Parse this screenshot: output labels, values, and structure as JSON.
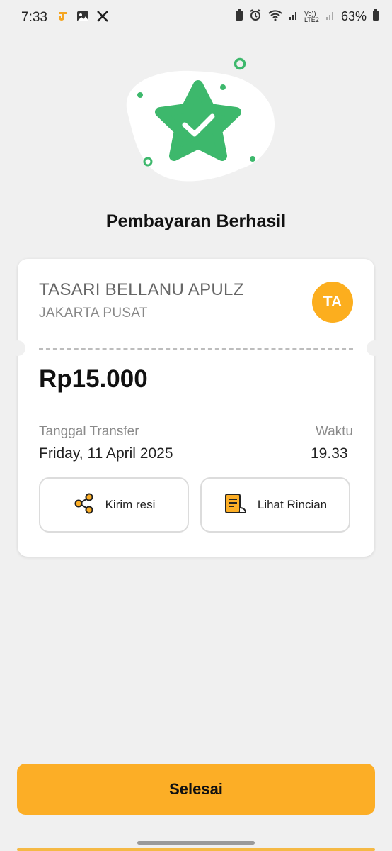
{
  "status_bar": {
    "time": "7:33",
    "battery": "63%",
    "network": "Vo)) LTE2"
  },
  "title": "Pembayaran Berhasil",
  "recipient": {
    "name": "TASARI BELLANU APULZ",
    "city": "JAKARTA PUSAT",
    "initials": "TA"
  },
  "amount": "Rp15.000",
  "transfer": {
    "date_label": "Tanggal Transfer",
    "date_value": "Friday, 11 April 2025",
    "time_label": "Waktu",
    "time_value": "19.33"
  },
  "actions": {
    "share_label": "Kirim resi",
    "detail_label": "Lihat Rincian"
  },
  "done_label": "Selesai",
  "colors": {
    "accent": "#fcae26",
    "success": "#3db86c",
    "avatar": "#fcae1e"
  }
}
